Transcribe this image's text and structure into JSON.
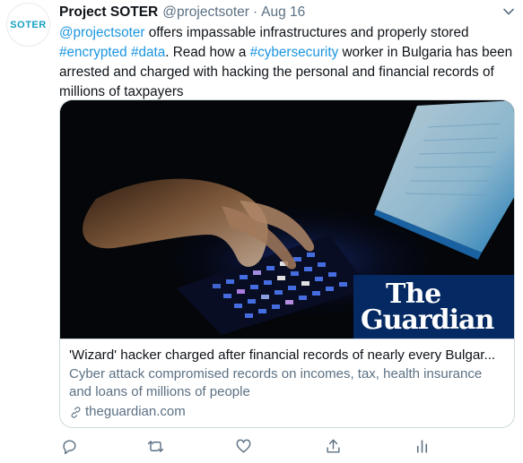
{
  "author": {
    "avatar_text": "SOTER",
    "display_name": "Project SOTER",
    "handle": "@projectsoter",
    "separator": "·",
    "date": "Aug 16"
  },
  "tweet": {
    "segments": [
      {
        "text": "@projectsoter",
        "link": true
      },
      {
        "text": " offers impassable infrastructures and properly stored ",
        "link": false
      },
      {
        "text": "#encrypted",
        "link": true
      },
      {
        "text": "  ",
        "link": false
      },
      {
        "text": "#data",
        "link": true
      },
      {
        "text": ". Read how a ",
        "link": false
      },
      {
        "text": "#cybersecurity",
        "link": true
      },
      {
        "text": " worker in Bulgaria has been arrested and charged with hacking the personal and financial records of millions of taxpayers",
        "link": false
      }
    ]
  },
  "card": {
    "image_logo": {
      "line1": "The",
      "line2": "Guardian"
    },
    "title": "'Wizard' hacker charged after financial records of nearly every Bulgar...",
    "description": "Cyber attack compromised records on incomes, tax, health insurance and loans of millions of people",
    "domain": "theguardian.com"
  },
  "actions": [
    {
      "name": "reply-button",
      "icon": "reply-icon"
    },
    {
      "name": "retweet-button",
      "icon": "retweet-icon"
    },
    {
      "name": "like-button",
      "icon": "heart-icon"
    },
    {
      "name": "share-button",
      "icon": "share-icon"
    },
    {
      "name": "analytics-button",
      "icon": "analytics-icon"
    }
  ],
  "colors": {
    "link": "#1b95e0",
    "secondary_text": "#5b7083",
    "guardian_blue": "#052962",
    "soter_teal": "#16a0c3"
  }
}
